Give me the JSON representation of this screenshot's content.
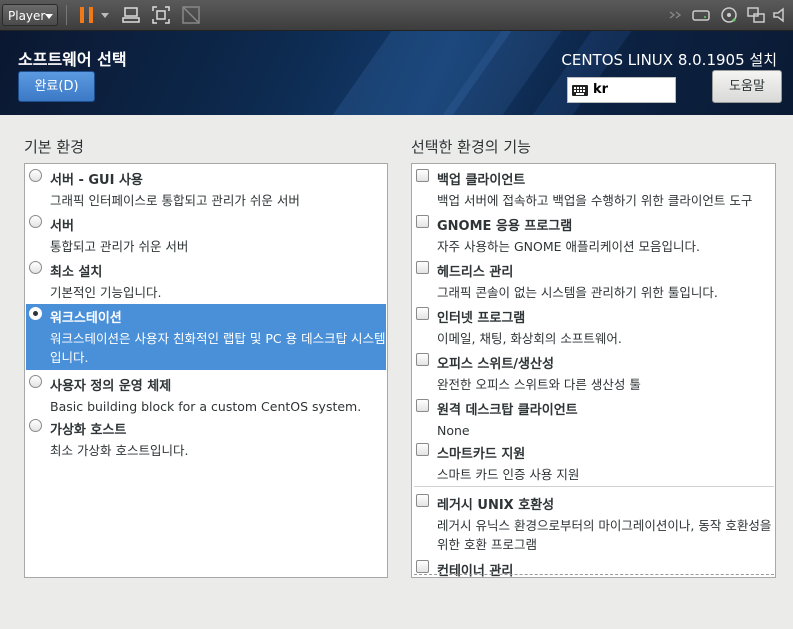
{
  "player": {
    "menu_label": "Player",
    "toolbar_icons": [
      "pause-icon",
      "dropdown-icon",
      "send-ctrl-alt-del-icon",
      "fit-guest-icon",
      "unity-icon"
    ],
    "device_icons": [
      "forward-icon",
      "hard-disk-icon",
      "cd-icon",
      "network-icon",
      "sound-icon"
    ]
  },
  "header": {
    "page_title": "소프트웨어 선택",
    "done_label": "완료(D)",
    "product_title": "CENTOS LINUX 8.0.1905 설치",
    "keyboard_layout": "kr",
    "help_label": "도움말"
  },
  "environments": {
    "heading": "기본 환경",
    "items": [
      {
        "name": "서버 - GUI 사용",
        "description": "그래픽 인터페이스로 통합되고 관리가 쉬운 서버",
        "selected": false
      },
      {
        "name": "서버",
        "description": "통합되고 관리가 쉬운 서버",
        "selected": false
      },
      {
        "name": "최소 설치",
        "description": "기본적인 기능입니다.",
        "selected": false
      },
      {
        "name": "워크스테이션",
        "description": "워크스테이션은 사용자 친화적인 랩탑 및 PC 용 데스크탑 시스템입니다.",
        "selected": true
      },
      {
        "name": "사용자 정의 운영 체제",
        "description": "Basic building block for a custom CentOS system.",
        "selected": false
      },
      {
        "name": "가상화 호스트",
        "description": "최소 가상화 호스트입니다.",
        "selected": false
      }
    ]
  },
  "addons": {
    "heading": "선택한 환경의 기능",
    "items": [
      {
        "name": "백업 클라이언트",
        "description": "백업 서버에 접속하고 백업을 수행하기 위한 클라이언트 도구",
        "checked": false
      },
      {
        "name": "GNOME 응용 프로그램",
        "description": "자주 사용하는 GNOME 애플리케이션 모음입니다.",
        "checked": false
      },
      {
        "name": "헤드리스 관리",
        "description": "그래픽 콘솔이 없는 시스템을 관리하기 위한 툴입니다.",
        "checked": false
      },
      {
        "name": "인터넷 프로그램",
        "description": "이메일, 채팅, 화상회의 소프트웨어.",
        "checked": false
      },
      {
        "name": "오피스 스위트/생산성",
        "description": "완전한 오피스 스위트와 다른 생산성 툴",
        "checked": false
      },
      {
        "name": "원격 데스크탑 클라이언트",
        "description": "None",
        "checked": false
      },
      {
        "name": "스마트카드 지원",
        "description": "스마트 카드 인증 사용 지원",
        "checked": false
      },
      {
        "name": "레거시 UNIX 호환성",
        "description": "레거시 유닉스 환경으로부터의 마이그레이션이나, 동작 호환성을 위한 호환 프로그램",
        "checked": false
      },
      {
        "name": "컨테이너 관리",
        "description": "",
        "checked": false
      }
    ]
  }
}
